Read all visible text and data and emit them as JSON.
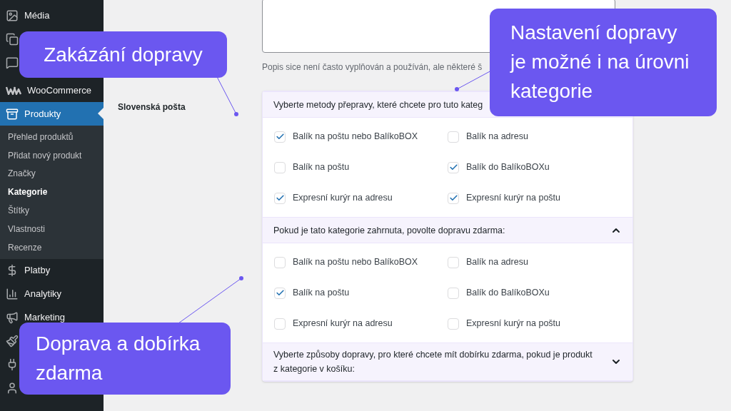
{
  "sidebar": {
    "items": [
      {
        "label": "Média",
        "selected": false
      },
      {
        "selected": false
      },
      {
        "selected": false
      },
      {
        "label": "WooCommerce",
        "selected": false
      },
      {
        "label": "Produkty",
        "selected": true,
        "children": [
          {
            "label": "Přehled produktů",
            "selected": false
          },
          {
            "label": "Přidat nový produkt",
            "selected": false
          },
          {
            "label": "Značky",
            "selected": false
          },
          {
            "label": "Kategorie",
            "selected": true
          },
          {
            "label": "Štítky",
            "selected": false
          },
          {
            "label": "Vlastnosti",
            "selected": false
          },
          {
            "label": "Recenze",
            "selected": false
          }
        ]
      },
      {
        "label": "Platby",
        "selected": false
      },
      {
        "label": "Analytiky",
        "selected": false
      },
      {
        "label": "Marketing",
        "selected": false
      },
      {
        "selected": false
      },
      {
        "selected": false
      },
      {
        "selected": false
      }
    ]
  },
  "description": {
    "help": "Popis sice není často vyplňován a používán, ale některé š"
  },
  "field_label": "Slovenská pošta",
  "sections": [
    {
      "title": "Vyberte metody přepravy, které chcete pro tuto kateg",
      "options": [
        {
          "label": "Balík na poštu nebo BalíkoBOX",
          "checked": true
        },
        {
          "label": "Balík na adresu",
          "checked": false
        },
        {
          "label": "Balík na poštu",
          "checked": false
        },
        {
          "label": "Balík do BalíkoBOXu",
          "checked": true
        },
        {
          "label": "Expresní kurýr na adresu",
          "checked": true
        },
        {
          "label": "Expresní kurýr na poštu",
          "checked": true
        }
      ]
    },
    {
      "title": "Pokud je tato kategorie zahrnuta, povolte dopravu zdarma:",
      "expanded": true,
      "options": [
        {
          "label": "Balík na poštu nebo BalíkoBOX",
          "checked": false
        },
        {
          "label": "Balík na adresu",
          "checked": false
        },
        {
          "label": "Balík na poštu",
          "checked": true
        },
        {
          "label": "Balík do BalíkoBOXu",
          "checked": false
        },
        {
          "label": "Expresní kurýr na adresu",
          "checked": false
        },
        {
          "label": "Expresní kurýr na poštu",
          "checked": false
        }
      ]
    },
    {
      "title": "Vyberte způsoby dopravy, pro které chcete mít dobírku zdarma, pokud je produkt z kategorie v košíku:",
      "expanded": false
    }
  ],
  "callouts": [
    {
      "text": "Zakázání dopravy"
    },
    {
      "text": "Nastavení dopravy je možné i na úrovni kategorie"
    },
    {
      "text": "Doprava a dobírka zdarma"
    }
  ]
}
